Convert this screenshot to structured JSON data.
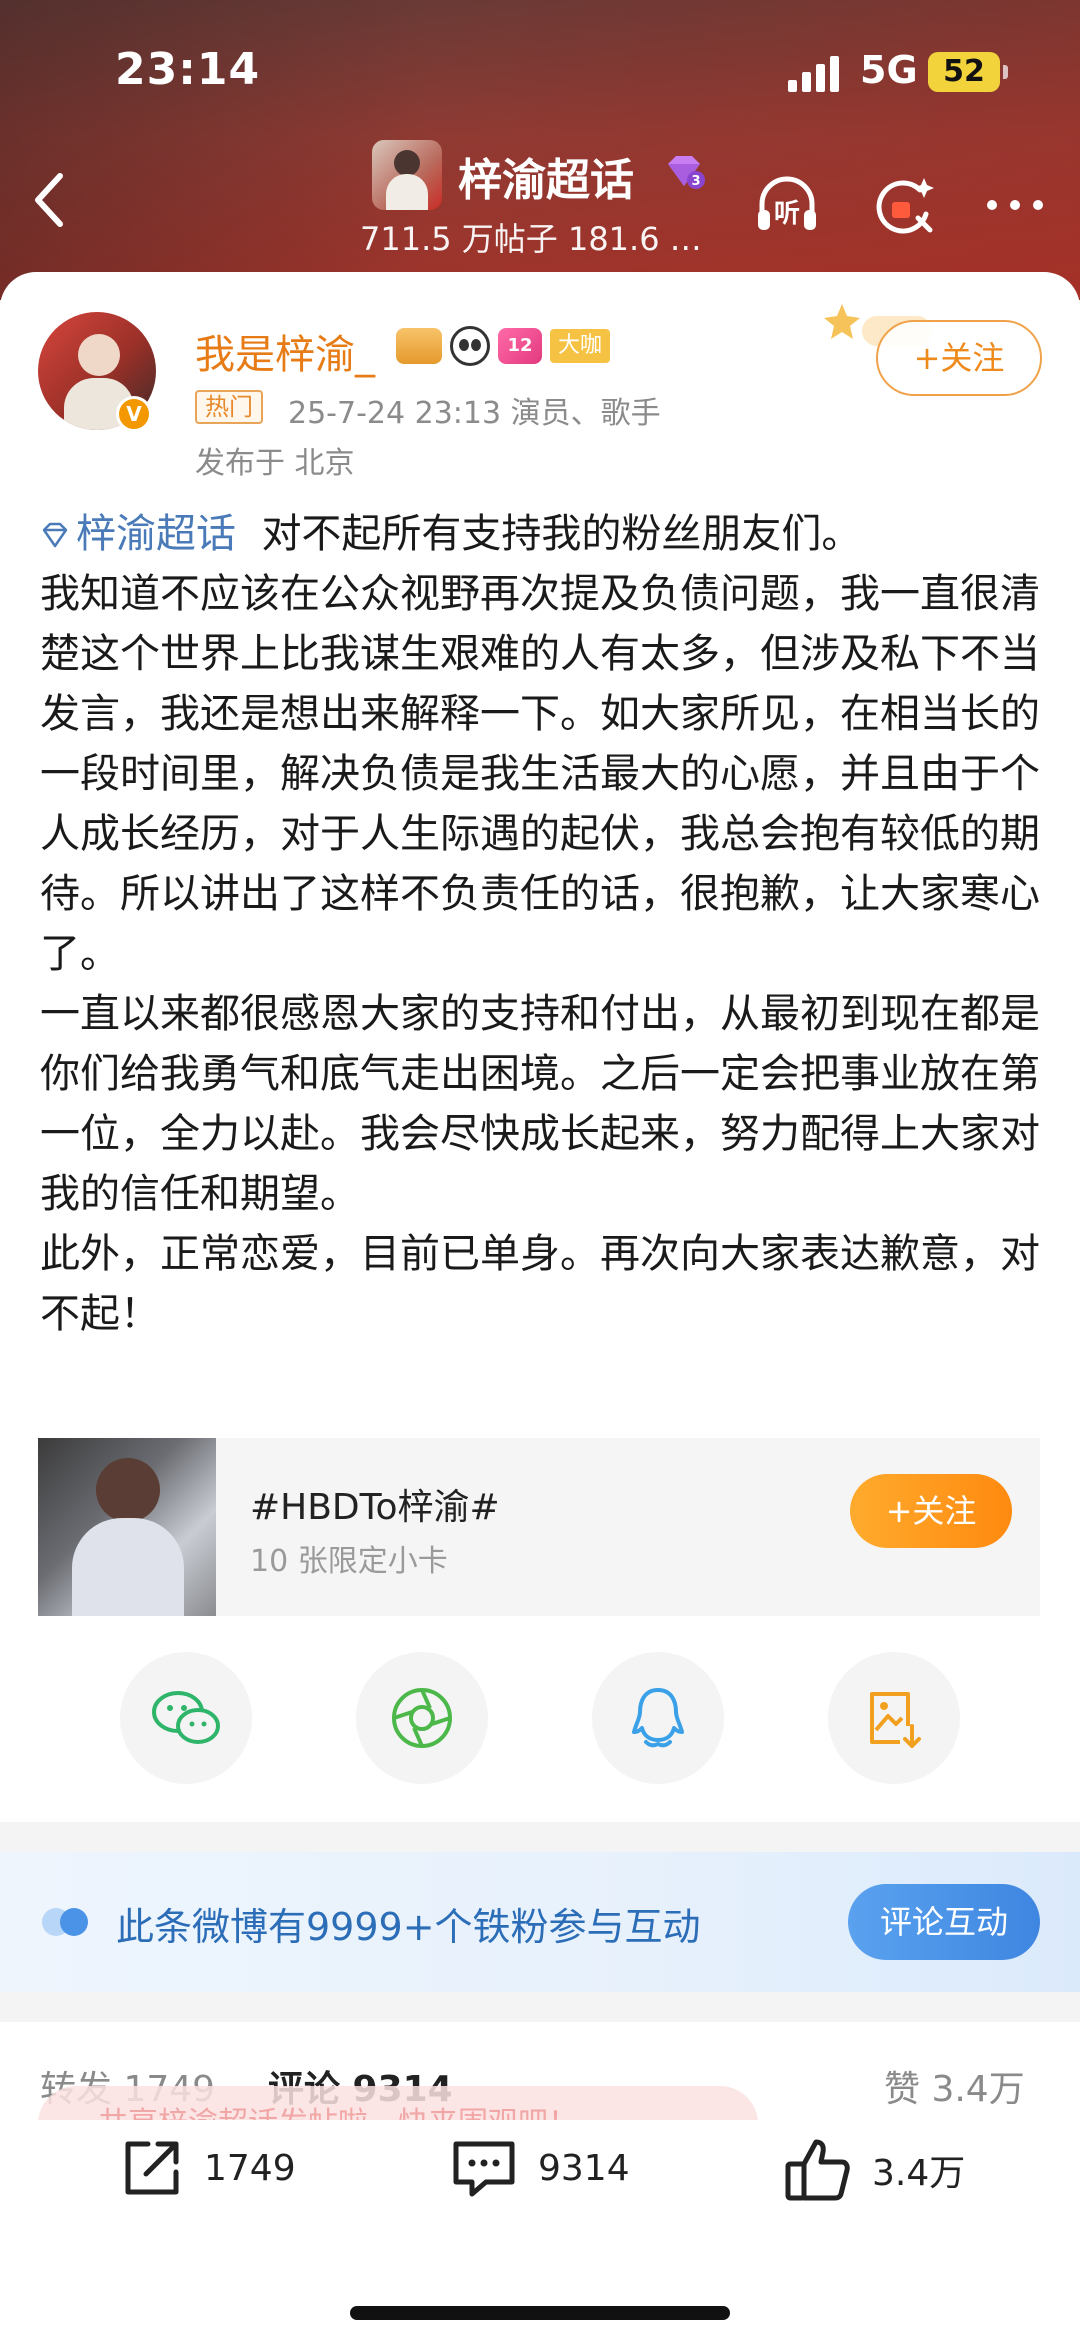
{
  "status_bar": {
    "time": "23:14",
    "network": "5G",
    "battery": "52"
  },
  "topnav": {
    "title": "梓渝超话",
    "subtitle": "711.5 万帖子 181.6 …",
    "icons": [
      "back-icon",
      "listen-icon",
      "search-icon",
      "more-icon"
    ]
  },
  "post": {
    "username": "我是梓渝_",
    "badge_big": "大咖",
    "badge_level": "12",
    "hot_tag": "热门",
    "meta": "25-7-24 23:13  演员、歌手",
    "location": "发布于 北京",
    "follow_label": "+关注",
    "topic_link": "梓渝超话",
    "paragraphs": [
      "对不起所有支持我的粉丝朋友们。",
      "我知道不应该在公众视野再次提及负债问题，我一直很清楚这个世界上比我谋生艰难的人有太多，但涉及私下不当发言，我还是想出来解释一下。如大家所见，在相当长的一段时间里，解决负债是我生活最大的心愿，并且由于个人成长经历，对于人生际遇的起伏，我总会抱有较低的期待。所以讲出了这样不负责任的话，很抱歉，让大家寒心了。",
      "一直以来都很感恩大家的支持和付出，从最初到现在都是你们给我勇气和底气走出困境。之后一定会把事业放在第一位，全力以赴。我会尽快成长起来，努力配得上大家对我的信任和期望。",
      "此外，正常恋爱，目前已单身。再次向大家表达歉意，对不起！"
    ]
  },
  "promo": {
    "title": "#HBDTo梓渝#",
    "subtitle": "10 张限定小卡",
    "follow_label": "+关注"
  },
  "share": [
    "wechat-icon",
    "moments-icon",
    "qq-icon",
    "save-image-icon"
  ],
  "fans_banner": {
    "text": "此条微博有9999+个铁粉参与互动",
    "button": "评论互动"
  },
  "tabs": {
    "repost": "转发 1749",
    "comment": "评论 9314",
    "like": "赞 3.4万",
    "toast": "共享梓渝超话发帖啦，快来围观吧！"
  },
  "actions": {
    "repost": "1749",
    "comment": "9314",
    "like": "3.4万"
  },
  "colors": {
    "accent_orange": "#ee8a1b",
    "link_blue": "#4a7ab8",
    "fans_blue": "#2c6db8"
  }
}
